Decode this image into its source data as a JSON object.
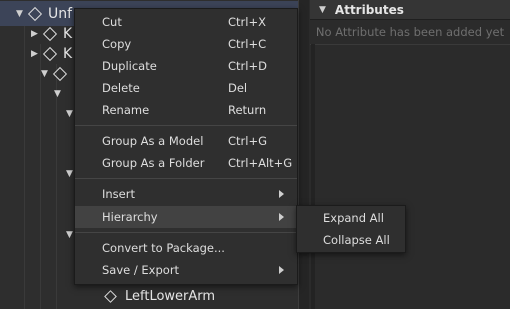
{
  "explorer": {
    "selected_item": "Unf",
    "rows": [
      {
        "label": "K"
      },
      {
        "label": "K"
      }
    ],
    "last_item": "LeftLowerArm"
  },
  "properties": {
    "section_title": "Attributes",
    "empty_text": "No Attribute has been added yet"
  },
  "context_menu": {
    "items": [
      {
        "label": "Cut",
        "shortcut": "Ctrl+X"
      },
      {
        "label": "Copy",
        "shortcut": "Ctrl+C"
      },
      {
        "label": "Duplicate",
        "shortcut": "Ctrl+D"
      },
      {
        "label": "Delete",
        "shortcut": "Del"
      },
      {
        "label": "Rename",
        "shortcut": "Return"
      },
      {
        "label": "Group As a Model",
        "shortcut": "Ctrl+G"
      },
      {
        "label": "Group As a Folder",
        "shortcut": "Ctrl+Alt+G"
      },
      {
        "label": "Insert",
        "shortcut": ""
      },
      {
        "label": "Hierarchy",
        "shortcut": ""
      },
      {
        "label": "Convert to Package...",
        "shortcut": ""
      },
      {
        "label": "Save / Export",
        "shortcut": ""
      }
    ]
  },
  "hierarchy_submenu": {
    "items": [
      {
        "label": "Expand All"
      },
      {
        "label": "Collapse All"
      }
    ]
  },
  "icons": {
    "expand": "caret-down-icon",
    "collapse": "caret-right-icon",
    "instance": "diamond-icon",
    "submenu": "submenu-arrow-icon"
  }
}
